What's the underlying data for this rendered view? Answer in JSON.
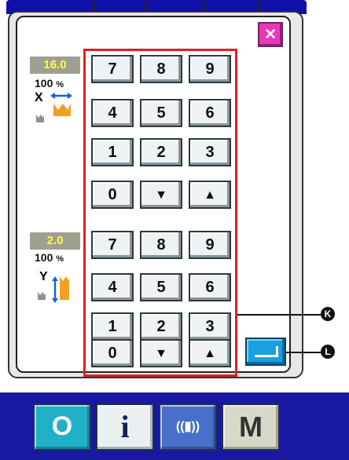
{
  "close_label": "×",
  "x_setting": {
    "value": "16.0",
    "percent": "100",
    "percent_unit": "%",
    "axis_label": "X"
  },
  "y_setting": {
    "value": "2.0",
    "percent": "100",
    "percent_unit": "%",
    "axis_label": "Y"
  },
  "keypad_x": {
    "rows": [
      [
        "7",
        "8",
        "9"
      ],
      [
        "4",
        "5",
        "6"
      ],
      [
        "1",
        "2",
        "3"
      ],
      [
        "0",
        "▼",
        "▲"
      ]
    ]
  },
  "keypad_y": {
    "rows": [
      [
        "7",
        "8",
        "9"
      ],
      [
        "4",
        "5",
        "6"
      ],
      [
        "1",
        "2",
        "3"
      ],
      [
        "0",
        "▼",
        "▲"
      ]
    ]
  },
  "callouts": {
    "keypad": "K",
    "enter": "L"
  },
  "bottom_bar": {
    "reset_glyph": "O",
    "info_glyph": "i",
    "comm_glyph": "((▮))",
    "mode_glyph": "M"
  },
  "colors": {
    "close": "#e838b8",
    "value_text": "#ffff40",
    "keypad_frame": "#e02020",
    "enter": "#18a0e0",
    "panel_blue": "#1818a0"
  }
}
